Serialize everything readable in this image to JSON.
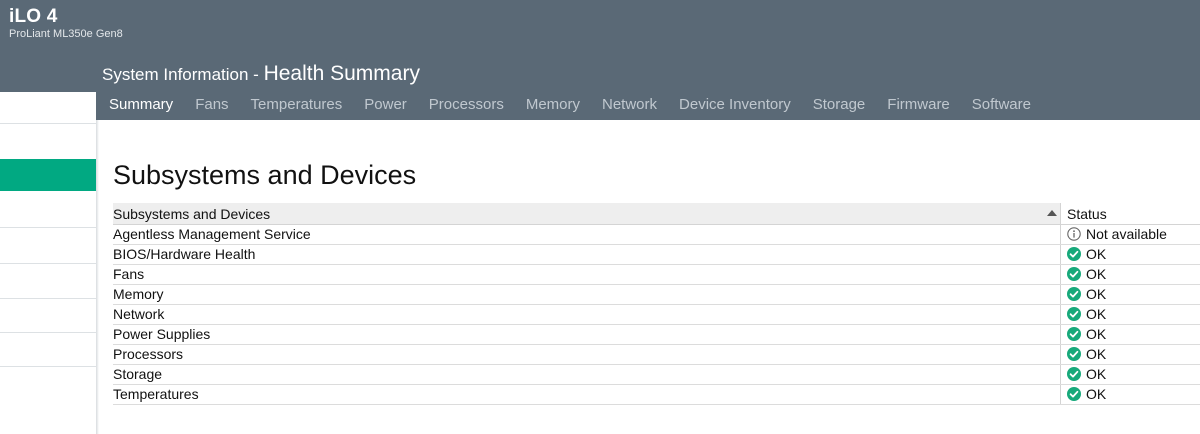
{
  "app": {
    "title": "iLO 4",
    "server_model": "ProLiant ML350e Gen8"
  },
  "header": {
    "section": "System Information",
    "separator": " - ",
    "page": "Health Summary"
  },
  "tabs": [
    {
      "label": "Summary",
      "active": true
    },
    {
      "label": "Fans",
      "active": false
    },
    {
      "label": "Temperatures",
      "active": false
    },
    {
      "label": "Power",
      "active": false
    },
    {
      "label": "Processors",
      "active": false
    },
    {
      "label": "Memory",
      "active": false
    },
    {
      "label": "Network",
      "active": false
    },
    {
      "label": "Device Inventory",
      "active": false
    },
    {
      "label": "Storage",
      "active": false
    },
    {
      "label": "Firmware",
      "active": false
    },
    {
      "label": "Software",
      "active": false
    }
  ],
  "content": {
    "title": "Subsystems and Devices",
    "table": {
      "columns": [
        "Subsystems and Devices",
        "Status"
      ],
      "sort": {
        "column": "Subsystems and Devices",
        "direction": "ascending"
      },
      "rows": [
        {
          "name": "Agentless Management Service",
          "status": "Not available",
          "status_icon": "info-icon"
        },
        {
          "name": "BIOS/Hardware Health",
          "status": "OK",
          "status_icon": "check-circle-icon"
        },
        {
          "name": "Fans",
          "status": "OK",
          "status_icon": "check-circle-icon"
        },
        {
          "name": "Memory",
          "status": "OK",
          "status_icon": "check-circle-icon"
        },
        {
          "name": "Network",
          "status": "OK",
          "status_icon": "check-circle-icon"
        },
        {
          "name": "Power Supplies",
          "status": "OK",
          "status_icon": "check-circle-icon"
        },
        {
          "name": "Processors",
          "status": "OK",
          "status_icon": "check-circle-icon"
        },
        {
          "name": "Storage",
          "status": "OK",
          "status_icon": "check-circle-icon"
        },
        {
          "name": "Temperatures",
          "status": "OK",
          "status_icon": "check-circle-icon"
        }
      ]
    }
  },
  "colors": {
    "header_bg": "#5a6976",
    "accent": "#01a982",
    "ok": "#17a97b",
    "info": "#666666"
  }
}
